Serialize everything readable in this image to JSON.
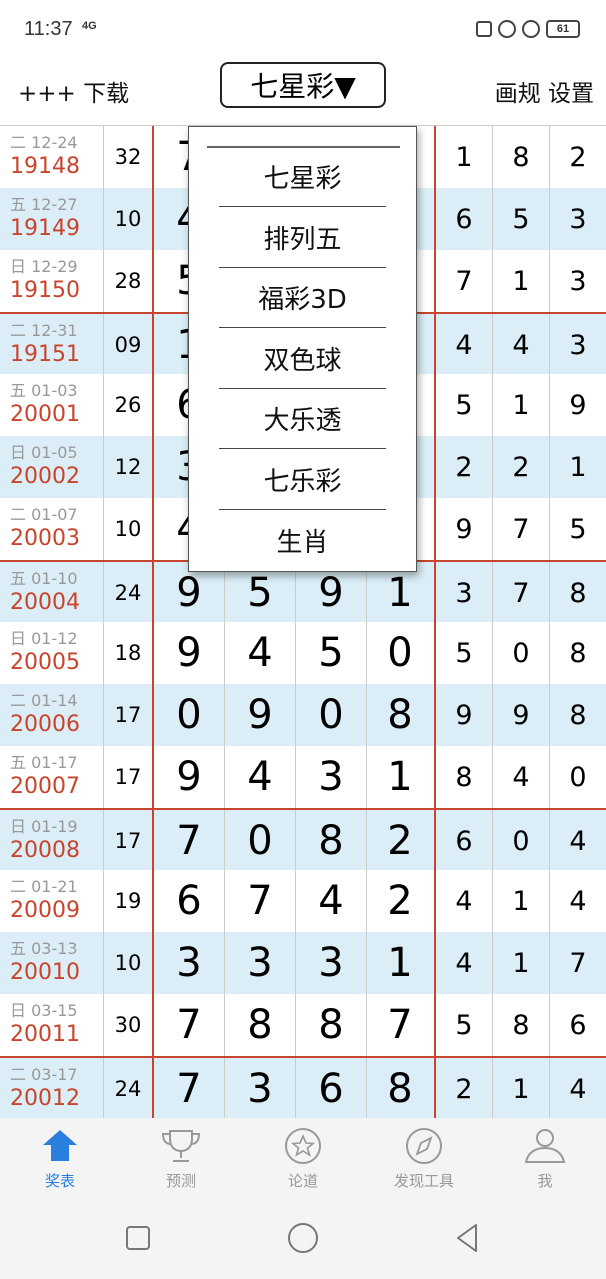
{
  "status_bar": {
    "time": "11:37",
    "network": "4G",
    "battery": "61"
  },
  "app_bar": {
    "left_label": "+++  下载",
    "selected_lottery": "七星彩▼",
    "right_label": "画规 设置"
  },
  "dropdown": {
    "items": [
      "七星彩",
      "排列五",
      "福彩3D",
      "双色球",
      "大乐透",
      "七乐彩",
      "生肖"
    ]
  },
  "table": {
    "rows": [
      {
        "day": "二",
        "date": "12-24",
        "issue": "19148",
        "sum": "32",
        "big": [
          "7",
          "",
          "",
          ""
        ],
        "small": [
          "1",
          "8",
          "2"
        ],
        "shade": "white",
        "split": false
      },
      {
        "day": "五",
        "date": "12-27",
        "issue": "19149",
        "sum": "10",
        "big": [
          "4",
          "",
          "",
          ""
        ],
        "small": [
          "6",
          "5",
          "3"
        ],
        "shade": "blue",
        "split": false
      },
      {
        "day": "日",
        "date": "12-29",
        "issue": "19150",
        "sum": "28",
        "big": [
          "5",
          "",
          "",
          ""
        ],
        "small": [
          "7",
          "1",
          "3"
        ],
        "shade": "white",
        "split": false
      },
      {
        "day": "二",
        "date": "12-31",
        "issue": "19151",
        "sum": "09",
        "big": [
          "1",
          "",
          "",
          ""
        ],
        "small": [
          "4",
          "4",
          "3"
        ],
        "shade": "blue",
        "split": true
      },
      {
        "day": "五",
        "date": "01-03",
        "issue": "20001",
        "sum": "26",
        "big": [
          "6",
          "",
          "",
          ""
        ],
        "small": [
          "5",
          "1",
          "9"
        ],
        "shade": "white",
        "split": false
      },
      {
        "day": "日",
        "date": "01-05",
        "issue": "20002",
        "sum": "12",
        "big": [
          "3",
          "",
          "",
          ""
        ],
        "small": [
          "2",
          "2",
          "1"
        ],
        "shade": "blue",
        "split": false
      },
      {
        "day": "二",
        "date": "01-07",
        "issue": "20003",
        "sum": "10",
        "big": [
          "4",
          "",
          "",
          ""
        ],
        "small": [
          "9",
          "7",
          "5"
        ],
        "shade": "white",
        "split": false
      },
      {
        "day": "五",
        "date": "01-10",
        "issue": "20004",
        "sum": "24",
        "big": [
          "9",
          "5",
          "9",
          "1"
        ],
        "small": [
          "3",
          "7",
          "8"
        ],
        "shade": "blue",
        "split": true
      },
      {
        "day": "日",
        "date": "01-12",
        "issue": "20005",
        "sum": "18",
        "big": [
          "9",
          "4",
          "5",
          "0"
        ],
        "small": [
          "5",
          "0",
          "8"
        ],
        "shade": "white",
        "split": false
      },
      {
        "day": "二",
        "date": "01-14",
        "issue": "20006",
        "sum": "17",
        "big": [
          "0",
          "9",
          "0",
          "8"
        ],
        "small": [
          "9",
          "9",
          "8"
        ],
        "shade": "blue",
        "split": false
      },
      {
        "day": "五",
        "date": "01-17",
        "issue": "20007",
        "sum": "17",
        "big": [
          "9",
          "4",
          "3",
          "1"
        ],
        "small": [
          "8",
          "4",
          "0"
        ],
        "shade": "white",
        "split": false
      },
      {
        "day": "日",
        "date": "01-19",
        "issue": "20008",
        "sum": "17",
        "big": [
          "7",
          "0",
          "8",
          "2"
        ],
        "small": [
          "6",
          "0",
          "4"
        ],
        "shade": "blue",
        "split": true
      },
      {
        "day": "二",
        "date": "01-21",
        "issue": "20009",
        "sum": "19",
        "big": [
          "6",
          "7",
          "4",
          "2"
        ],
        "small": [
          "4",
          "1",
          "4"
        ],
        "shade": "white",
        "split": false
      },
      {
        "day": "五",
        "date": "03-13",
        "issue": "20010",
        "sum": "10",
        "big": [
          "3",
          "3",
          "3",
          "1"
        ],
        "small": [
          "4",
          "1",
          "7"
        ],
        "shade": "blue",
        "split": false
      },
      {
        "day": "日",
        "date": "03-15",
        "issue": "20011",
        "sum": "30",
        "big": [
          "7",
          "8",
          "8",
          "7"
        ],
        "small": [
          "5",
          "8",
          "6"
        ],
        "shade": "white",
        "split": false
      },
      {
        "day": "二",
        "date": "03-17",
        "issue": "20012",
        "sum": "24",
        "big": [
          "7",
          "3",
          "6",
          "8"
        ],
        "small": [
          "2",
          "1",
          "4"
        ],
        "shade": "blue",
        "split": true
      }
    ]
  },
  "bottom_nav": {
    "items": [
      {
        "label": "奖表",
        "icon": "home-upload-icon",
        "active": true
      },
      {
        "label": "预测",
        "icon": "trophy-icon",
        "active": false
      },
      {
        "label": "论道",
        "icon": "star-circle-icon",
        "active": false
      },
      {
        "label": "发现工具",
        "icon": "compass-icon",
        "active": false
      },
      {
        "label": "我",
        "icon": "person-icon",
        "active": false
      }
    ]
  },
  "colors": {
    "accent_blue": "#2a7fde",
    "issue_red": "#c9442c",
    "row_blue": "#dbeef7"
  }
}
